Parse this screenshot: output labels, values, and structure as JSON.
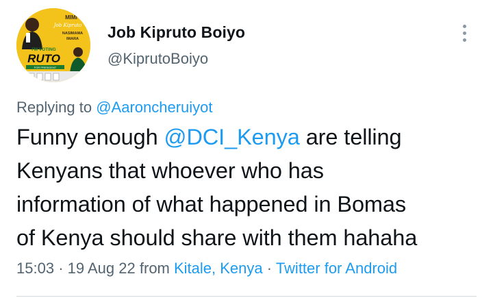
{
  "author": {
    "display_name": "Job Kipruto Boiyo",
    "handle": "@KiprutoBoiyo",
    "avatar": {
      "top_text": "MIMI",
      "script_name": "Job Kipruto",
      "kasimama": "NASIMAMA",
      "imara": "IMARA",
      "voting": "I'M VOTING",
      "ruto": "RUTO",
      "for_president": "FOR PRESIDENT"
    }
  },
  "reply": {
    "prefix": "Replying to",
    "mention": "@Aaroncheruiyot"
  },
  "tweet": {
    "line1_before": "Funny enough",
    "mention": "@DCI_Kenya",
    "line1_after": "are telling",
    "line2": "Kenyans that whoever who has",
    "line3": "information of what happened in Bomas",
    "line4": "of Kenya should share with them hahaha"
  },
  "meta": {
    "time": "15:03",
    "sep1": "·",
    "date": "19 Aug 22",
    "from": "from",
    "location": "Kitale, Kenya",
    "sep2": "·",
    "client": "Twitter for Android"
  },
  "icons": {
    "more": "more-vertical-icon"
  },
  "colors": {
    "link": "#1d9bf0",
    "secondary": "#536471",
    "primary": "#0f1419",
    "avatar_bg": "#f3c21b"
  }
}
